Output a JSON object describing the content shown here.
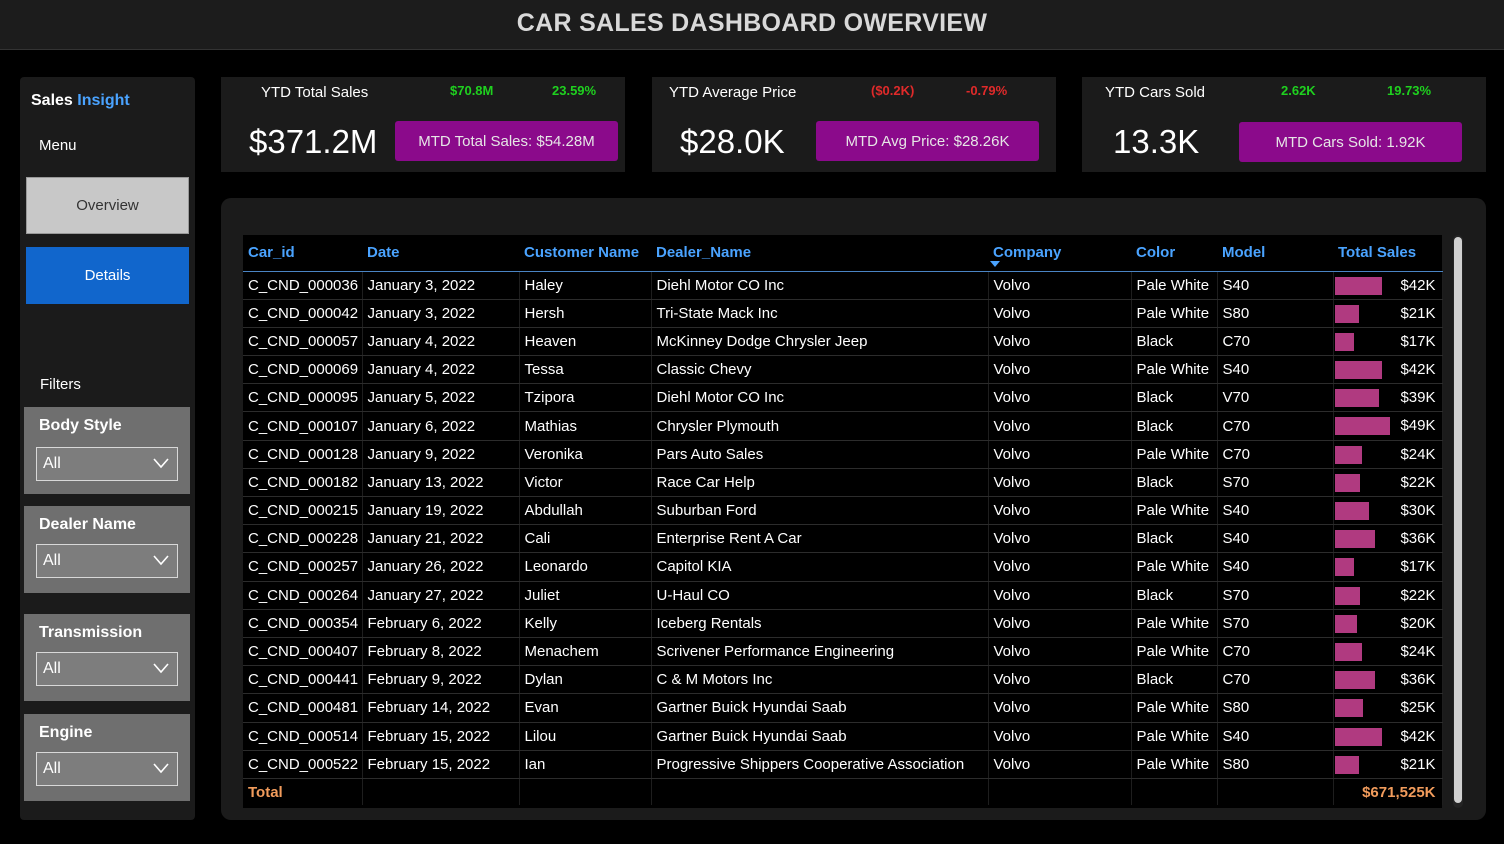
{
  "header": {
    "title": "CAR SALES DASHBOARD OWERVIEW"
  },
  "sidebar": {
    "brand_part1": "Sales",
    "brand_part2": "Insight",
    "menu_label": "Menu",
    "nav": [
      {
        "label": "Overview",
        "active": false
      },
      {
        "label": "Details",
        "active": true
      }
    ],
    "filters_label": "Filters",
    "filters": [
      {
        "title": "Body Style",
        "value": "All"
      },
      {
        "title": "Dealer Name",
        "value": "All"
      },
      {
        "title": "Transmission",
        "value": "All"
      },
      {
        "title": "Engine",
        "value": "All"
      }
    ]
  },
  "kpis": [
    {
      "label": "YTD Total Sales",
      "delta_value": "$70.8M",
      "delta_pct": "23.59%",
      "delta_status": "positive",
      "value": "$371.2M",
      "mtd_label": "MTD Total Sales: $54.28M"
    },
    {
      "label": "YTD Average Price",
      "delta_value": "($0.2K)",
      "delta_pct": "-0.79%",
      "delta_status": "negative",
      "value": "$28.0K",
      "mtd_label": "MTD Avg Price: $28.26K"
    },
    {
      "label": "YTD Cars Sold",
      "delta_value": "2.62K",
      "delta_pct": "19.73%",
      "delta_status": "positive",
      "value": "13.3K",
      "mtd_label": "MTD Cars Sold: 1.92K"
    }
  ],
  "colors": {
    "accent_blue": "#4aa3ff",
    "nav_active": "#1166cc",
    "mtd_button": "#8b0a8b",
    "bar": "#b03a80",
    "positive": "#1fd11f",
    "negative": "#e02a2a",
    "total_text": "#f29c5c"
  },
  "table": {
    "columns": [
      "Car_id",
      "Date",
      "Customer Name",
      "Dealer_Name",
      "Company",
      "Color",
      "Model",
      "Total Sales"
    ],
    "sorted_column": "Company",
    "rows": [
      {
        "car_id": "C_CND_000036",
        "date": "January 3, 2022",
        "customer": "Haley",
        "dealer": "Diehl Motor CO Inc",
        "company": "Volvo",
        "color": "Pale White",
        "model": "S40",
        "sales_label": "$42K",
        "sales": 42
      },
      {
        "car_id": "C_CND_000042",
        "date": "January 3, 2022",
        "customer": "Hersh",
        "dealer": "Tri-State Mack Inc",
        "company": "Volvo",
        "color": "Pale White",
        "model": "S80",
        "sales_label": "$21K",
        "sales": 21
      },
      {
        "car_id": "C_CND_000057",
        "date": "January 4, 2022",
        "customer": "Heaven",
        "dealer": "McKinney Dodge Chrysler Jeep",
        "company": "Volvo",
        "color": "Black",
        "model": "C70",
        "sales_label": "$17K",
        "sales": 17
      },
      {
        "car_id": "C_CND_000069",
        "date": "January 4, 2022",
        "customer": "Tessa",
        "dealer": "Classic Chevy",
        "company": "Volvo",
        "color": "Pale White",
        "model": "S40",
        "sales_label": "$42K",
        "sales": 42
      },
      {
        "car_id": "C_CND_000095",
        "date": "January 5, 2022",
        "customer": "Tzipora",
        "dealer": "Diehl Motor CO Inc",
        "company": "Volvo",
        "color": "Black",
        "model": "V70",
        "sales_label": "$39K",
        "sales": 39
      },
      {
        "car_id": "C_CND_000107",
        "date": "January 6, 2022",
        "customer": "Mathias",
        "dealer": "Chrysler Plymouth",
        "company": "Volvo",
        "color": "Black",
        "model": "C70",
        "sales_label": "$49K",
        "sales": 49
      },
      {
        "car_id": "C_CND_000128",
        "date": "January 9, 2022",
        "customer": "Veronika",
        "dealer": "Pars Auto Sales",
        "company": "Volvo",
        "color": "Pale White",
        "model": "C70",
        "sales_label": "$24K",
        "sales": 24
      },
      {
        "car_id": "C_CND_000182",
        "date": "January 13, 2022",
        "customer": "Victor",
        "dealer": "Race Car Help",
        "company": "Volvo",
        "color": "Black",
        "model": "S70",
        "sales_label": "$22K",
        "sales": 22
      },
      {
        "car_id": "C_CND_000215",
        "date": "January 19, 2022",
        "customer": "Abdullah",
        "dealer": "Suburban Ford",
        "company": "Volvo",
        "color": "Pale White",
        "model": "S40",
        "sales_label": "$30K",
        "sales": 30
      },
      {
        "car_id": "C_CND_000228",
        "date": "January 21, 2022",
        "customer": "Cali",
        "dealer": "Enterprise Rent A Car",
        "company": "Volvo",
        "color": "Black",
        "model": "S40",
        "sales_label": "$36K",
        "sales": 36
      },
      {
        "car_id": "C_CND_000257",
        "date": "January 26, 2022",
        "customer": "Leonardo",
        "dealer": "Capitol KIA",
        "company": "Volvo",
        "color": "Pale White",
        "model": "S40",
        "sales_label": "$17K",
        "sales": 17
      },
      {
        "car_id": "C_CND_000264",
        "date": "January 27, 2022",
        "customer": "Juliet",
        "dealer": "U-Haul CO",
        "company": "Volvo",
        "color": "Black",
        "model": "S70",
        "sales_label": "$22K",
        "sales": 22
      },
      {
        "car_id": "C_CND_000354",
        "date": "February 6, 2022",
        "customer": "Kelly",
        "dealer": "Iceberg Rentals",
        "company": "Volvo",
        "color": "Pale White",
        "model": "S70",
        "sales_label": "$20K",
        "sales": 20
      },
      {
        "car_id": "C_CND_000407",
        "date": "February 8, 2022",
        "customer": "Menachem",
        "dealer": "Scrivener Performance Engineering",
        "company": "Volvo",
        "color": "Pale White",
        "model": "C70",
        "sales_label": "$24K",
        "sales": 24
      },
      {
        "car_id": "C_CND_000441",
        "date": "February 9, 2022",
        "customer": "Dylan",
        "dealer": "C & M Motors Inc",
        "company": "Volvo",
        "color": "Black",
        "model": "C70",
        "sales_label": "$36K",
        "sales": 36
      },
      {
        "car_id": "C_CND_000481",
        "date": "February 14, 2022",
        "customer": "Evan",
        "dealer": "Gartner Buick Hyundai Saab",
        "company": "Volvo",
        "color": "Pale White",
        "model": "S80",
        "sales_label": "$25K",
        "sales": 25
      },
      {
        "car_id": "C_CND_000514",
        "date": "February 15, 2022",
        "customer": "Lilou",
        "dealer": "Gartner Buick Hyundai Saab",
        "company": "Volvo",
        "color": "Pale White",
        "model": "S40",
        "sales_label": "$42K",
        "sales": 42
      },
      {
        "car_id": "C_CND_000522",
        "date": "February 15, 2022",
        "customer": "Ian",
        "dealer": "Progressive Shippers Cooperative Association",
        "company": "Volvo",
        "color": "Pale White",
        "model": "S80",
        "sales_label": "$21K",
        "sales": 21
      }
    ],
    "total_label": "Total",
    "total_value": "$671,525K"
  }
}
